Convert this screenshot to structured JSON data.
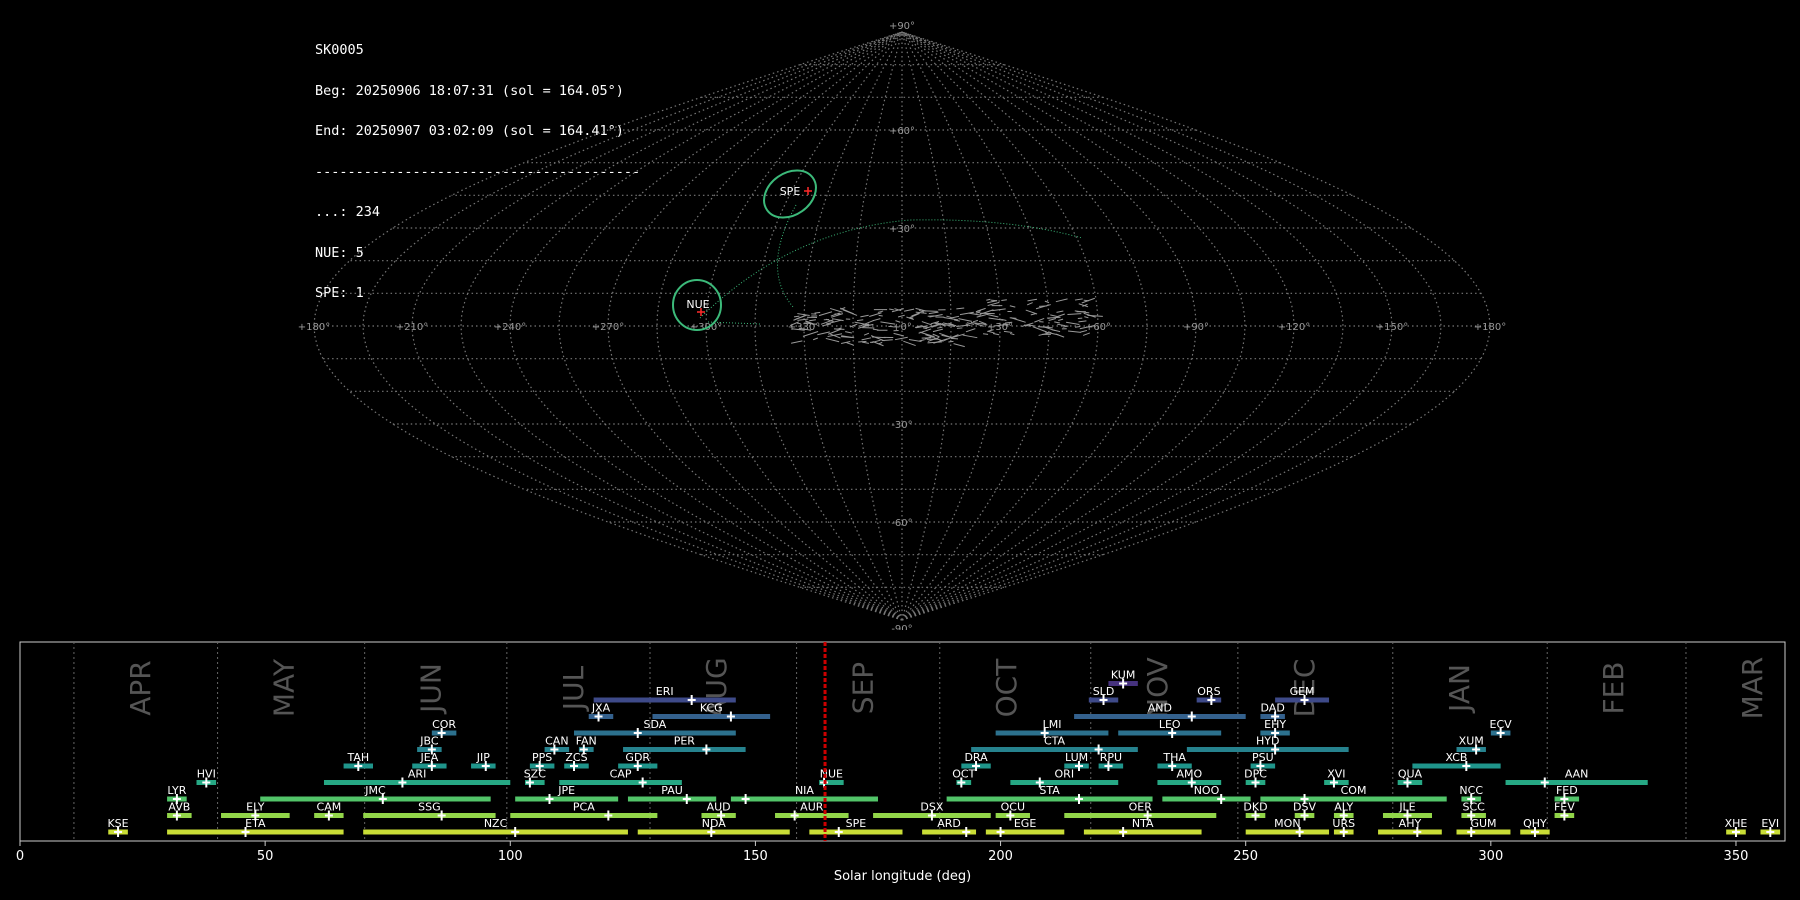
{
  "info": {
    "id": "SK0005",
    "beg": "Beg: 20250906 18:07:31 (sol = 164.05°)",
    "end": "End: 20250907 03:02:09 (sol = 164.41°)",
    "sep": "----------------------------------------",
    "counts": [
      "...: 234",
      "NUE: 5",
      "SPE: 1"
    ]
  },
  "sky_map": {
    "projection": "sinusoidal",
    "lon_labels": [
      "+180°",
      "+150°",
      "+120°",
      "+90°",
      "+60°",
      "+30°",
      "+0°",
      "+330°",
      "+300°",
      "+270°",
      "+240°",
      "+210°",
      "+180°"
    ],
    "lat_labels": [
      "+90°",
      "+60°",
      "+30°",
      "-30°",
      "-60°",
      "-90°"
    ],
    "highlighted": [
      {
        "code": "NUE",
        "lon": 60,
        "lat": -5
      },
      {
        "code": "SPE",
        "lon": 38,
        "lat": 27
      }
    ],
    "colors": {
      "grid": "#777777",
      "ellipse": "#3cba7a",
      "radiant": "#ff2a2a"
    }
  },
  "chart_data": {
    "type": "bar",
    "xlabel": "Solar longitude (deg)",
    "xlim": [
      0,
      360
    ],
    "xticks": [
      "0",
      "50",
      "100",
      "150",
      "200",
      "250",
      "300",
      "350"
    ],
    "current_sol": 164.2,
    "months": [
      {
        "label": "APR",
        "start": 11
      },
      {
        "label": "MAY",
        "start": 40.3
      },
      {
        "label": "JUN",
        "start": 70.3
      },
      {
        "label": "JUL",
        "start": 99.3
      },
      {
        "label": "AUG",
        "start": 128.5
      },
      {
        "label": "SEP",
        "start": 158.4
      },
      {
        "label": "OCT",
        "start": 187.6
      },
      {
        "label": "NOV",
        "start": 218.4
      },
      {
        "label": "DEC",
        "start": 248.4
      },
      {
        "label": "JAN",
        "start": 280
      },
      {
        "label": "FEB",
        "start": 311.5
      },
      {
        "label": "MAR",
        "start": 339.8
      }
    ],
    "showers": [
      {
        "code": "KUM",
        "row": 9,
        "start": 222,
        "end": 228,
        "peak": 225
      },
      {
        "code": "SLD",
        "row": 8,
        "start": 218,
        "end": 224,
        "peak": 221
      },
      {
        "code": "ERI",
        "row": 8,
        "start": 117,
        "end": 146,
        "peak": 137
      },
      {
        "code": "ORS",
        "row": 8,
        "start": 240,
        "end": 245,
        "peak": 243
      },
      {
        "code": "GEM",
        "row": 8,
        "start": 256,
        "end": 267,
        "peak": 262
      },
      {
        "code": "JXA",
        "row": 7,
        "start": 116,
        "end": 121,
        "peak": 118
      },
      {
        "code": "KCG",
        "row": 7,
        "start": 129,
        "end": 153,
        "peak": 145
      },
      {
        "code": "AND",
        "row": 7,
        "start": 215,
        "end": 250,
        "peak": 239
      },
      {
        "code": "DAD",
        "row": 7,
        "start": 253,
        "end": 258,
        "peak": 256
      },
      {
        "code": "COR",
        "row": 6,
        "start": 84,
        "end": 89,
        "peak": 86
      },
      {
        "code": "SDA",
        "row": 6,
        "start": 113,
        "end": 146,
        "peak": 126
      },
      {
        "code": "LMI",
        "row": 6,
        "start": 199,
        "end": 222,
        "peak": 209
      },
      {
        "code": "LEO",
        "row": 6,
        "start": 224,
        "end": 245,
        "peak": 235
      },
      {
        "code": "EHY",
        "row": 6,
        "start": 253,
        "end": 259,
        "peak": 256
      },
      {
        "code": "ECV",
        "row": 6,
        "start": 300,
        "end": 304,
        "peak": 302
      },
      {
        "code": "JBC",
        "row": 5,
        "start": 81,
        "end": 86,
        "peak": 84
      },
      {
        "code": "CAN",
        "row": 5,
        "start": 107,
        "end": 112,
        "peak": 109
      },
      {
        "code": "FAN",
        "row": 5,
        "start": 114,
        "end": 117,
        "peak": 115
      },
      {
        "code": "PER",
        "row": 5,
        "start": 123,
        "end": 148,
        "peak": 140
      },
      {
        "code": "CTA",
        "row": 5,
        "start": 194,
        "end": 228,
        "peak": 220
      },
      {
        "code": "HYD",
        "row": 5,
        "start": 238,
        "end": 271,
        "peak": 256
      },
      {
        "code": "XUM",
        "row": 5,
        "start": 293,
        "end": 299,
        "peak": 297
      },
      {
        "code": "TAH",
        "row": 4,
        "start": 66,
        "end": 72,
        "peak": 69
      },
      {
        "code": "JEA",
        "row": 4,
        "start": 80,
        "end": 87,
        "peak": 84
      },
      {
        "code": "JIP",
        "row": 4,
        "start": 92,
        "end": 97,
        "peak": 95
      },
      {
        "code": "PPS",
        "row": 4,
        "start": 104,
        "end": 109,
        "peak": 106
      },
      {
        "code": "ZCS",
        "row": 4,
        "start": 111,
        "end": 116,
        "peak": 113
      },
      {
        "code": "GDR",
        "row": 4,
        "start": 122,
        "end": 130,
        "peak": 126
      },
      {
        "code": "DRA",
        "row": 4,
        "start": 192,
        "end": 198,
        "peak": 195
      },
      {
        "code": "LUM",
        "row": 4,
        "start": 213,
        "end": 218,
        "peak": 216
      },
      {
        "code": "RPU",
        "row": 4,
        "start": 220,
        "end": 225,
        "peak": 222
      },
      {
        "code": "THA",
        "row": 4,
        "start": 232,
        "end": 239,
        "peak": 235
      },
      {
        "code": "PSU",
        "row": 4,
        "start": 251,
        "end": 256,
        "peak": 253
      },
      {
        "code": "XCB",
        "row": 4,
        "start": 284,
        "end": 302,
        "peak": 295
      },
      {
        "code": "HVI",
        "row": 3,
        "start": 36,
        "end": 40,
        "peak": 38
      },
      {
        "code": "ARI",
        "row": 3,
        "start": 62,
        "end": 100,
        "peak": 78
      },
      {
        "code": "SZC",
        "row": 3,
        "start": 103,
        "end": 107,
        "peak": 104
      },
      {
        "code": "CAP",
        "row": 3,
        "start": 110,
        "end": 135,
        "peak": 127
      },
      {
        "code": "NUE",
        "row": 3,
        "start": 163,
        "end": 168,
        "peak": 164
      },
      {
        "code": "OCT",
        "row": 3,
        "start": 191,
        "end": 194,
        "peak": 192
      },
      {
        "code": "ORI",
        "row": 3,
        "start": 202,
        "end": 224,
        "peak": 208
      },
      {
        "code": "AMO",
        "row": 3,
        "start": 232,
        "end": 245,
        "peak": 239
      },
      {
        "code": "DPC",
        "row": 3,
        "start": 250,
        "end": 254,
        "peak": 252
      },
      {
        "code": "XVI",
        "row": 3,
        "start": 266,
        "end": 271,
        "peak": 268
      },
      {
        "code": "QUA",
        "row": 3,
        "start": 281,
        "end": 286,
        "peak": 283
      },
      {
        "code": "AAN",
        "row": 3,
        "start": 303,
        "end": 332,
        "peak": 311
      },
      {
        "code": "LYR",
        "row": 2,
        "start": 30,
        "end": 34,
        "peak": 32
      },
      {
        "code": "JMC",
        "row": 2,
        "start": 49,
        "end": 96,
        "peak": 74
      },
      {
        "code": "JPE",
        "row": 2,
        "start": 101,
        "end": 122,
        "peak": 108
      },
      {
        "code": "PAU",
        "row": 2,
        "start": 124,
        "end": 142,
        "peak": 136
      },
      {
        "code": "NIA",
        "row": 2,
        "start": 145,
        "end": 175,
        "peak": 148
      },
      {
        "code": "STA",
        "row": 2,
        "start": 189,
        "end": 231,
        "peak": 216
      },
      {
        "code": "NOO",
        "row": 2,
        "start": 233,
        "end": 251,
        "peak": 245
      },
      {
        "code": "COM",
        "row": 2,
        "start": 253,
        "end": 291,
        "peak": 262
      },
      {
        "code": "NCC",
        "row": 2,
        "start": 294,
        "end": 298,
        "peak": 296
      },
      {
        "code": "FED",
        "row": 2,
        "start": 313,
        "end": 318,
        "peak": 315
      },
      {
        "code": "AVB",
        "row": 1,
        "start": 30,
        "end": 35,
        "peak": 32
      },
      {
        "code": "ELY",
        "row": 1,
        "start": 41,
        "end": 55,
        "peak": 48
      },
      {
        "code": "CAM",
        "row": 1,
        "start": 60,
        "end": 66,
        "peak": 63
      },
      {
        "code": "SSG",
        "row": 1,
        "start": 70,
        "end": 97,
        "peak": 86
      },
      {
        "code": "PCA",
        "row": 1,
        "start": 100,
        "end": 130,
        "peak": 120
      },
      {
        "code": "AUD",
        "row": 1,
        "start": 139,
        "end": 146,
        "peak": 143
      },
      {
        "code": "AUR",
        "row": 1,
        "start": 154,
        "end": 169,
        "peak": 158
      },
      {
        "code": "DSX",
        "row": 1,
        "start": 174,
        "end": 198,
        "peak": 186
      },
      {
        "code": "OCU",
        "row": 1,
        "start": 199,
        "end": 206,
        "peak": 202
      },
      {
        "code": "OER",
        "row": 1,
        "start": 213,
        "end": 244,
        "peak": 230
      },
      {
        "code": "DKD",
        "row": 1,
        "start": 250,
        "end": 254,
        "peak": 252
      },
      {
        "code": "DSV",
        "row": 1,
        "start": 260,
        "end": 264,
        "peak": 262
      },
      {
        "code": "ALY",
        "row": 1,
        "start": 268,
        "end": 272,
        "peak": 270
      },
      {
        "code": "JLE",
        "row": 1,
        "start": 278,
        "end": 288,
        "peak": 283
      },
      {
        "code": "SCC",
        "row": 1,
        "start": 294,
        "end": 299,
        "peak": 296
      },
      {
        "code": "FEV",
        "row": 1,
        "start": 313,
        "end": 317,
        "peak": 315
      },
      {
        "code": "KSE",
        "row": 0,
        "start": 18,
        "end": 22,
        "peak": 20
      },
      {
        "code": "ETA",
        "row": 0,
        "start": 30,
        "end": 66,
        "peak": 46
      },
      {
        "code": "NZC",
        "row": 0,
        "start": 70,
        "end": 124,
        "peak": 101
      },
      {
        "code": "NDA",
        "row": 0,
        "start": 126,
        "end": 157,
        "peak": 141
      },
      {
        "code": "SPE",
        "row": 0,
        "start": 161,
        "end": 180,
        "peak": 167
      },
      {
        "code": "ARD",
        "row": 0,
        "start": 184,
        "end": 195,
        "peak": 193
      },
      {
        "code": "EGE",
        "row": 0,
        "start": 197,
        "end": 213,
        "peak": 200
      },
      {
        "code": "NTA",
        "row": 0,
        "start": 217,
        "end": 241,
        "peak": 225
      },
      {
        "code": "MON",
        "row": 0,
        "start": 250,
        "end": 267,
        "peak": 261
      },
      {
        "code": "URS",
        "row": 0,
        "start": 268,
        "end": 272,
        "peak": 270
      },
      {
        "code": "AHY",
        "row": 0,
        "start": 277,
        "end": 290,
        "peak": 285
      },
      {
        "code": "GUM",
        "row": 0,
        "start": 293,
        "end": 304,
        "peak": 296
      },
      {
        "code": "QHY",
        "row": 0,
        "start": 306,
        "end": 312,
        "peak": 309
      },
      {
        "code": "XHE",
        "row": 0,
        "start": 348,
        "end": 352,
        "peak": 350
      },
      {
        "code": "EVI",
        "row": 0,
        "start": 355,
        "end": 359,
        "peak": 357
      }
    ],
    "row_colors": [
      "#c9dd36",
      "#92d549",
      "#52c469",
      "#26a884",
      "#1f958b",
      "#26828e",
      "#2c718e",
      "#34618d",
      "#3e4a89",
      "#46327e"
    ],
    "current_color": "#cc0000"
  }
}
